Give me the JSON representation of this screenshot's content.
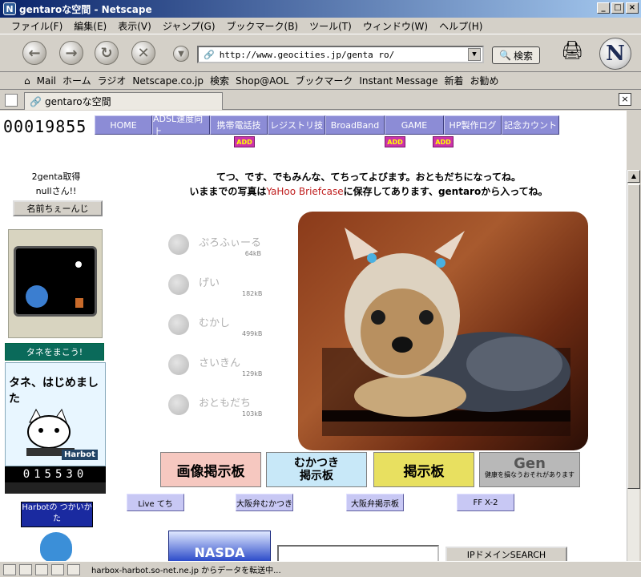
{
  "window": {
    "title": "gentaroな空間 - Netscape"
  },
  "menubar": [
    "ファイル(F)",
    "編集(E)",
    "表示(V)",
    "ジャンプ(G)",
    "ブックマーク(B)",
    "ツール(T)",
    "ウィンドウ(W)",
    "ヘルプ(H)"
  ],
  "toolbar": {
    "url": "http://www.geocities.jp/genta ro/",
    "search_label": "検索"
  },
  "personal_bar": [
    "Mail",
    "ホーム",
    "ラジオ",
    "Netscape.co.jp",
    "検索",
    "Shop@AOL",
    "ブックマーク",
    "Instant Message",
    "新着",
    "お勧め"
  ],
  "tab": {
    "title": "gentaroな空間"
  },
  "page": {
    "counter": "00019855",
    "nav": [
      "HOME",
      "ADSL速度向上",
      "携帯電話技",
      "レジストリ技",
      "BroadBand",
      "GAME",
      "HP製作ログ",
      "記念カウント"
    ],
    "add_tag": "ADD",
    "left": {
      "get_text_1": "2genta取得",
      "get_text_2": "nullさん!!",
      "name_button": "名前ちぇーんじ",
      "tane_banner": "タネをまこう!",
      "tane_title": "タネ、はじめました",
      "harbot_logo": "Harbot",
      "counter_digits": "015530",
      "harbot_how": "Harbotの\nつかいかた"
    },
    "message_line1": "てつ、です、でもみんな、てちってよびます。おともだちになってね。",
    "message_line2_pre": "いままでの写真は",
    "message_line2_link": "YaHoo Briefcase",
    "message_line2_post": "に保存してあります、gentaroから入ってね。",
    "menu": [
      {
        "label": "ぷろふぃーる",
        "size": "64kB"
      },
      {
        "label": "げい",
        "size": "182kB"
      },
      {
        "label": "むかし",
        "size": "499kB"
      },
      {
        "label": "さいきん",
        "size": "129kB"
      },
      {
        "label": "おともだち",
        "size": "103kB"
      }
    ],
    "banners": [
      "画像掲示板",
      "むかつき\n掲示板",
      "掲示板",
      "Gen"
    ],
    "banner_gen_sub": "健康を損なうおそれがあります",
    "bbs_buttons": [
      "Live てち",
      "大阪弁むかつき",
      "大阪弁掲示板",
      "FF X-2"
    ],
    "nasda": "NASDA",
    "ip_search": "IPドメインSEARCH"
  },
  "status": {
    "text": "harbox-harbot.so-net.ne.jp からデータを転送中..."
  }
}
